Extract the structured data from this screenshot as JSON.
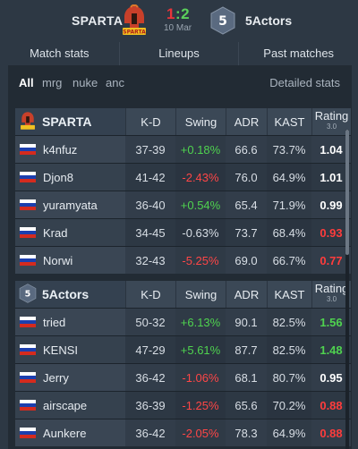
{
  "header": {
    "team1": "SPARTA",
    "team2": "5Actors",
    "score1": "1",
    "score_sep": ":",
    "score2": "2",
    "date": "10 Mar",
    "team2_logo_text": "5",
    "team1_logo_text": "SPARTA"
  },
  "tabs": [
    "Match stats",
    "Lineups",
    "Past matches"
  ],
  "filters": {
    "maps": [
      "All",
      "mrg",
      "nuke",
      "anc"
    ],
    "active": "All",
    "detailed": "Detailed stats"
  },
  "columns": {
    "kd": "K-D",
    "swing": "Swing",
    "adr": "ADR",
    "kast": "KAST",
    "rating": "Rating",
    "rating_version": "3.0"
  },
  "teams": [
    {
      "name": "SPARTA",
      "players": [
        {
          "name": "k4nfuz",
          "kd": "37-39",
          "swing": "+0.18%",
          "adr": "66.6",
          "kast": "73.7%",
          "rating": "1.04"
        },
        {
          "name": "Djon8",
          "kd": "41-42",
          "swing": "-2.43%",
          "adr": "76.0",
          "kast": "64.9%",
          "rating": "1.01"
        },
        {
          "name": "yuramyata",
          "kd": "36-40",
          "swing": "+0.54%",
          "adr": "65.4",
          "kast": "71.9%",
          "rating": "0.99"
        },
        {
          "name": "Krad",
          "kd": "34-45",
          "swing": "-0.63%",
          "adr": "73.7",
          "kast": "68.4%",
          "rating": "0.93"
        },
        {
          "name": "Norwi",
          "kd": "32-43",
          "swing": "-5.25%",
          "adr": "69.0",
          "kast": "66.7%",
          "rating": "0.77"
        }
      ]
    },
    {
      "name": "5Actors",
      "players": [
        {
          "name": "tried",
          "kd": "50-32",
          "swing": "+6.13%",
          "adr": "90.1",
          "kast": "82.5%",
          "rating": "1.56"
        },
        {
          "name": "KENSI",
          "kd": "47-29",
          "swing": "+5.61%",
          "adr": "87.7",
          "kast": "82.5%",
          "rating": "1.48"
        },
        {
          "name": "Jerry",
          "kd": "36-42",
          "swing": "-1.06%",
          "adr": "68.1",
          "kast": "80.7%",
          "rating": "0.95"
        },
        {
          "name": "airscape",
          "kd": "36-39",
          "swing": "-1.25%",
          "adr": "65.6",
          "kast": "70.2%",
          "rating": "0.88"
        },
        {
          "name": "Aunkere",
          "kd": "36-42",
          "swing": "-2.05%",
          "adr": "78.3",
          "kast": "64.9%",
          "rating": "0.88"
        }
      ]
    }
  ],
  "colors": {
    "positive": "#4fd24f",
    "negative": "#ff4646",
    "score_loss": "#e8343a",
    "score_win": "#5bd05b"
  },
  "icons": {
    "player_flag": "russia-flag-icon",
    "team1_logo": "sparta-logo-icon",
    "team2_logo": "5actors-logo-icon"
  }
}
